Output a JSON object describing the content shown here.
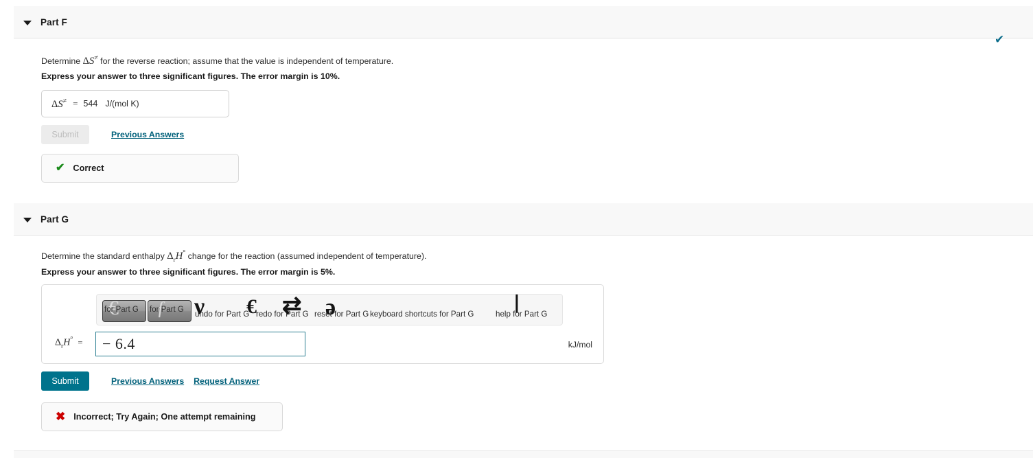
{
  "parts": {
    "f": {
      "title": "Part F",
      "caret_icon": "caret-down-icon",
      "status_icon": "check-icon",
      "prompt_pre": "Determine ",
      "prompt_symbol_delta": "Δ",
      "prompt_symbol_var": "S",
      "prompt_symbol_sup": "≠",
      "prompt_post": " for the reverse reaction; assume that the value is independent of temperature.",
      "instruction": "Express your answer to three significant figures. The error margin is 10%.",
      "answer": {
        "symbol_delta": "Δ",
        "symbol_var": "S",
        "symbol_sup": "≠",
        "equals": "=",
        "value": "544",
        "units": "J/(mol K)"
      },
      "submit_label": "Submit",
      "previous_answers_label": "Previous Answers",
      "feedback_icon": "check-icon",
      "feedback_text": "Correct"
    },
    "g": {
      "title": "Part G",
      "caret_icon": "caret-down-icon",
      "prompt_pre": "Determine the standard enthalpy ",
      "prompt_symbol_delta": "Δ",
      "prompt_symbol_sub": "r",
      "prompt_symbol_var": "H",
      "prompt_symbol_sup": "°",
      "prompt_post": " change for the reaction (assumed independent of temperature).",
      "instruction": "Express your answer to three significant figures. The error margin is 5%.",
      "toolbar": {
        "palette_buttons": [
          {
            "alt": "for Part G",
            "glyph": "€"
          },
          {
            "alt": "for Part G",
            "glyph": "ƒ"
          }
        ],
        "items": [
          {
            "alt": "undo for Part G",
            "glyph": "ν"
          },
          {
            "alt": "redo for Part G",
            "glyph": "€"
          },
          {
            "alt": "reset for Part G",
            "glyph": "⇄"
          },
          {
            "alt": "keyboard shortcuts for Part G",
            "glyph": "ə"
          },
          {
            "alt": "help for Part G",
            "glyph": "❘"
          }
        ]
      },
      "answer": {
        "symbol_delta": "Δ",
        "symbol_sub": "r",
        "symbol_var": "H",
        "symbol_sup": "°",
        "equals": "=",
        "value": "− 6.4",
        "units": "kJ/mol"
      },
      "submit_label": "Submit",
      "previous_answers_label": "Previous Answers",
      "request_answer_label": "Request Answer",
      "feedback_icon": "cross-icon",
      "feedback_text": "Incorrect; Try Again; One attempt remaining"
    }
  },
  "colors": {
    "submit_enabled": "#00738c",
    "link": "#00607a",
    "correct": "#1a8a1a",
    "incorrect": "#cc0000",
    "status_check": "#0d6e8c",
    "input_focus_border": "#2b7e91"
  }
}
